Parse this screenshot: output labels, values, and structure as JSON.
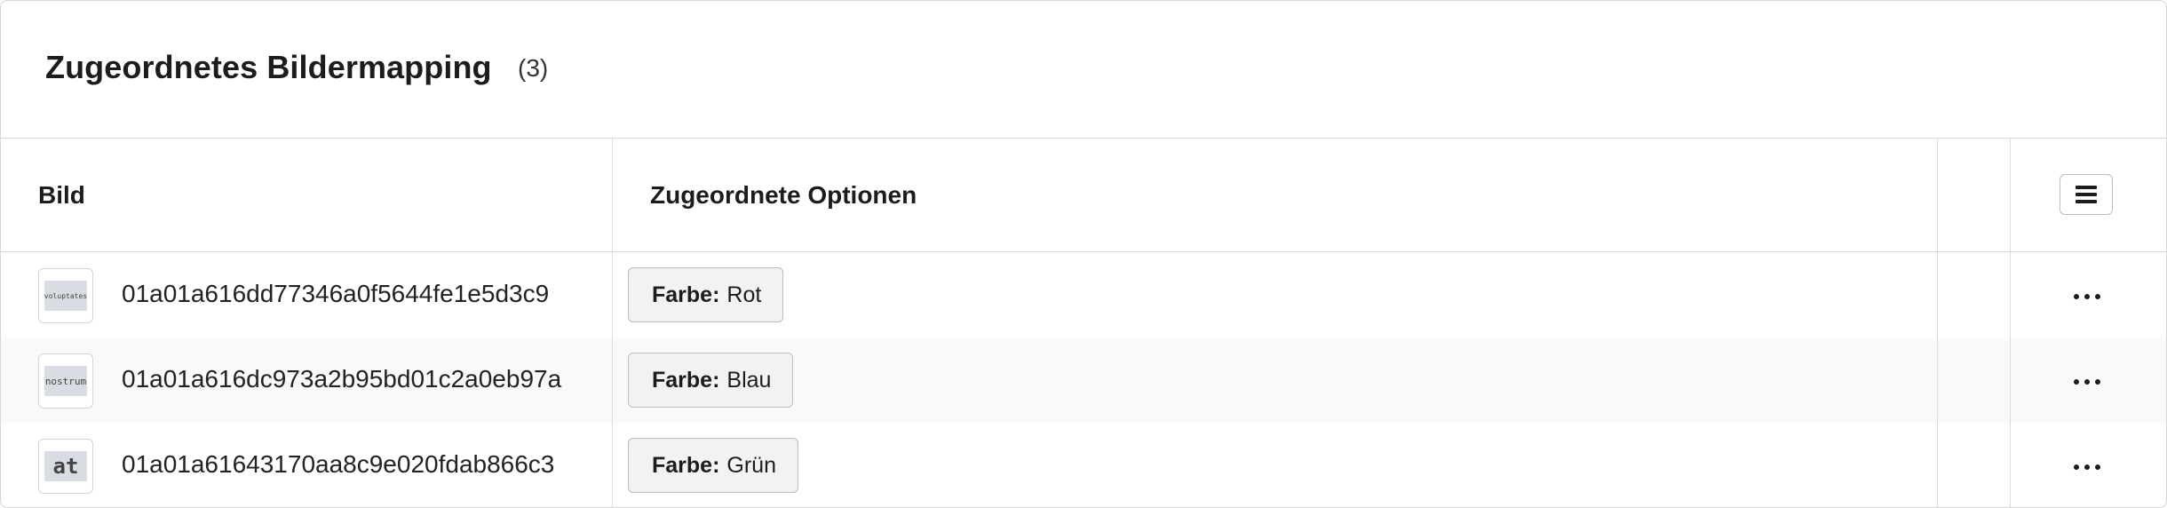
{
  "header": {
    "title": "Zugeordnetes Bildermapping",
    "count": "(3)"
  },
  "table": {
    "columns": [
      "Bild",
      "Zugeordnete Optionen",
      "",
      ""
    ],
    "rows": [
      {
        "thumb_text": "voluptates",
        "image_id": "01a01a616dd77346a0f5644fe1e5d3c9",
        "option_label": "Farbe:",
        "option_value": "Rot"
      },
      {
        "thumb_text": "nostrum",
        "image_id": "01a01a616dc973a2b95bd01c2a0eb97a",
        "option_label": "Farbe:",
        "option_value": "Blau"
      },
      {
        "thumb_text": "at",
        "image_id": "01a01a61643170aa8c9e020fdab866c3",
        "option_label": "Farbe:",
        "option_value": "Grün"
      }
    ]
  },
  "icons": {
    "column_menu": "hamburger-menu-icon",
    "row_actions": "more-horizontal-icon"
  },
  "colors": {
    "border": "#dcdcdc",
    "tag_bg": "#f1f2f4",
    "thumb_bg": "#d9dce3",
    "alt_row_bg": "#f8f9fb"
  }
}
